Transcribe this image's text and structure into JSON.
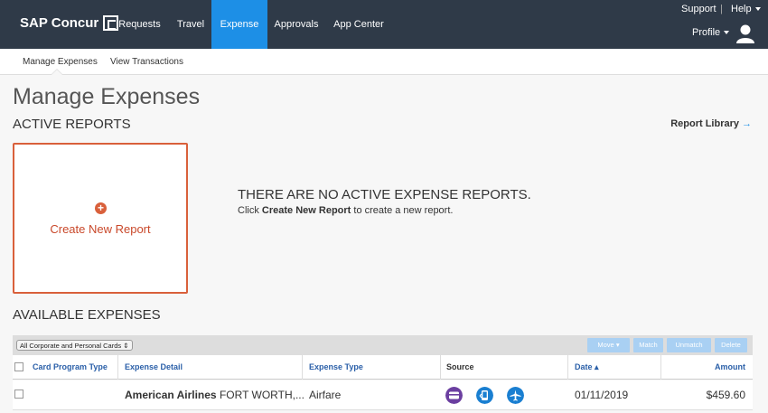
{
  "app": {
    "brand": "SAP Concur",
    "nav": [
      "Requests",
      "Travel",
      "Expense",
      "Approvals",
      "App Center"
    ],
    "active_nav": "Expense",
    "support": "Support",
    "help": "Help",
    "profile": "Profile"
  },
  "subnav": {
    "items": [
      "Manage Expenses",
      "View Transactions"
    ]
  },
  "page": {
    "title": "Manage Expenses",
    "active_reports_heading": "ACTIVE REPORTS",
    "report_library": "Report Library",
    "create_new_report": "Create New Report",
    "no_reports_title": "THERE ARE NO ACTIVE EXPENSE REPORTS.",
    "no_reports_pre": "Click",
    "no_reports_link": "Create New Report",
    "no_reports_post": "to create a new report.",
    "available_heading": "AVAILABLE EXPENSES"
  },
  "expenses": {
    "filter": "All Corporate and Personal Cards",
    "buttons": [
      "Move",
      "Match",
      "Unmatch",
      "Delete"
    ],
    "columns": [
      "Card Program Type",
      "Expense Detail",
      "Expense Type",
      "Source",
      "Date",
      "Amount"
    ],
    "rows": [
      {
        "card_program_type": "",
        "vendor": "American Airlines",
        "location": "FORT WORTH,...",
        "expense_type": "Airfare",
        "source_icons": [
          "card-icon",
          "phone-icon",
          "airplane-icon"
        ],
        "date": "01/11/2019",
        "amount": "$459.60"
      }
    ]
  },
  "colors": {
    "nav_bg": "#2f3a48",
    "accent": "#1d8fe6",
    "create_border": "#d9603b",
    "link_blue": "#2a5fa8",
    "card_icon": "#6b3fa0",
    "phone_icon": "#1a7fd1",
    "plane_icon": "#1a7fd1"
  }
}
